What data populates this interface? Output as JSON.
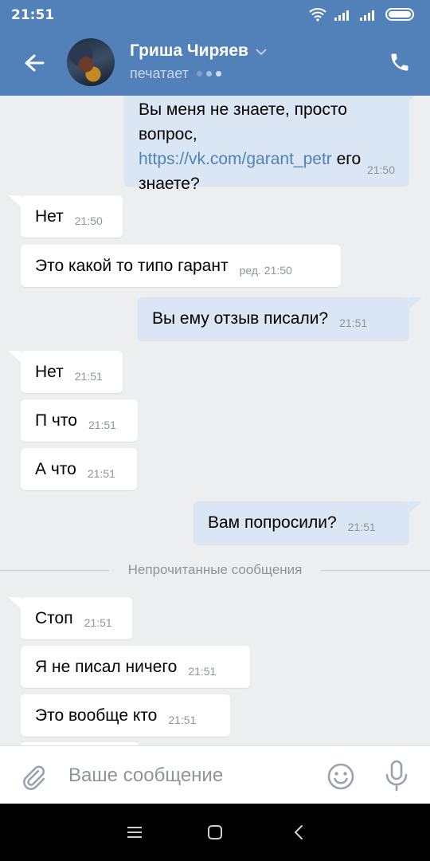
{
  "status_bar": {
    "time": "21:51",
    "icons": [
      "wifi-icon",
      "signal-icon",
      "signal-icon",
      "battery-icon"
    ]
  },
  "header": {
    "back_icon": "arrow-left-icon",
    "contact_name": "Гриша Чиряев",
    "status_text": "печатает",
    "call_icon": "phone-icon"
  },
  "messages": [
    {
      "direction": "out",
      "text_parts": [
        "Вы меня не знаете, просто вопрос, ",
        "https://vk.com/garant_petr",
        " его знаете?"
      ],
      "time": "21:50"
    },
    {
      "direction": "in",
      "text": "Нет",
      "time": "21:50"
    },
    {
      "direction": "in",
      "text": "Это какой то типо гарант",
      "time": "ред. 21:50"
    },
    {
      "direction": "out",
      "text": "Вы ему отзыв писали?",
      "time": "21:51"
    },
    {
      "direction": "in",
      "text": "Нет",
      "time": "21:51"
    },
    {
      "direction": "in",
      "text": "П что",
      "time": "21:51"
    },
    {
      "direction": "in",
      "text": "А что",
      "time": "21:51"
    },
    {
      "direction": "out",
      "text": "Вам попросили?",
      "time": "21:51"
    },
    {
      "direction": "in",
      "text": "Стоп",
      "time": "21:51"
    },
    {
      "direction": "in",
      "text": "Я не писал ничего",
      "time": "21:51"
    },
    {
      "direction": "in",
      "text": "Это вообще кто",
      "time": "21:51"
    }
  ],
  "unread_divider": "Непрочитанные сообщения",
  "composer": {
    "placeholder": "Ваше сообщение",
    "attach_icon": "paperclip-icon",
    "emoji_icon": "smile-icon",
    "mic_icon": "microphone-icon"
  },
  "nav_bar": {
    "icons": [
      "menu-icon",
      "home-square-icon",
      "back-chevron-icon"
    ]
  },
  "colors": {
    "header_bg": "#5181b8",
    "chat_bg": "#edeef0",
    "incoming_bubble": "#ffffff",
    "outgoing_bubble": "#dae6f4",
    "link": "#5181b8",
    "time_text": "#8f9499"
  }
}
